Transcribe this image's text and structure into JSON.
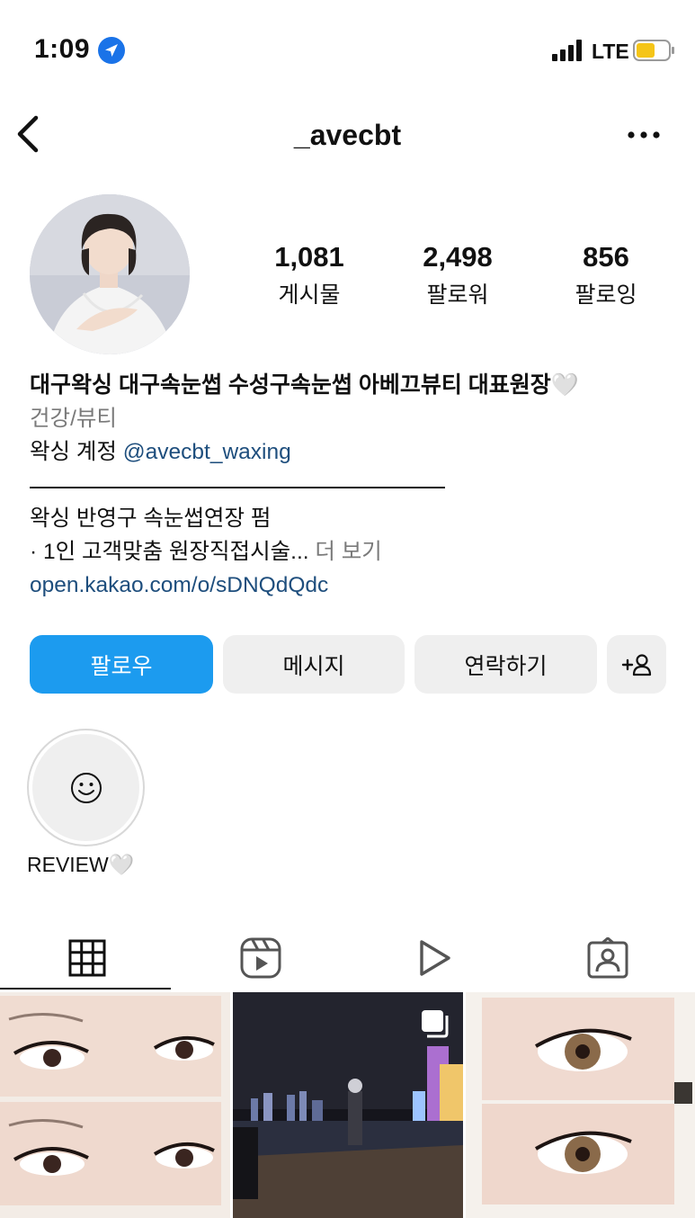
{
  "status_bar": {
    "time": "1:09",
    "network": "LTE"
  },
  "header": {
    "username": "_avecbt"
  },
  "profile": {
    "stats": [
      {
        "value": "1,081",
        "label": "게시물"
      },
      {
        "value": "2,498",
        "label": "팔로워"
      },
      {
        "value": "856",
        "label": "팔로잉"
      }
    ],
    "name": "대구왁싱 대구속눈썹 수성구속눈썹 아베끄뷰티 대표원장🤍",
    "category": "건강/뷰티",
    "line1_prefix": "왁싱 계정 ",
    "line1_mention": "@avecbt_waxing",
    "line2": "왁싱 반영구 속눈썹연장 펌",
    "line3": "· 1인 고객맞춤 원장직접시술... ",
    "more_label": "더 보기",
    "link": "open.kakao.com/o/sDNQdQdc"
  },
  "buttons": {
    "follow": "팔로우",
    "message": "메시지",
    "contact": "연락하기"
  },
  "highlight": {
    "label": "REVIEW🤍"
  },
  "tabs": [
    "grid-icon",
    "reels-icon",
    "video-icon",
    "tagged-icon"
  ],
  "colors": {
    "accent": "#1c9bef",
    "link": "#1e4e7d",
    "muted": "#7a7a7a"
  }
}
